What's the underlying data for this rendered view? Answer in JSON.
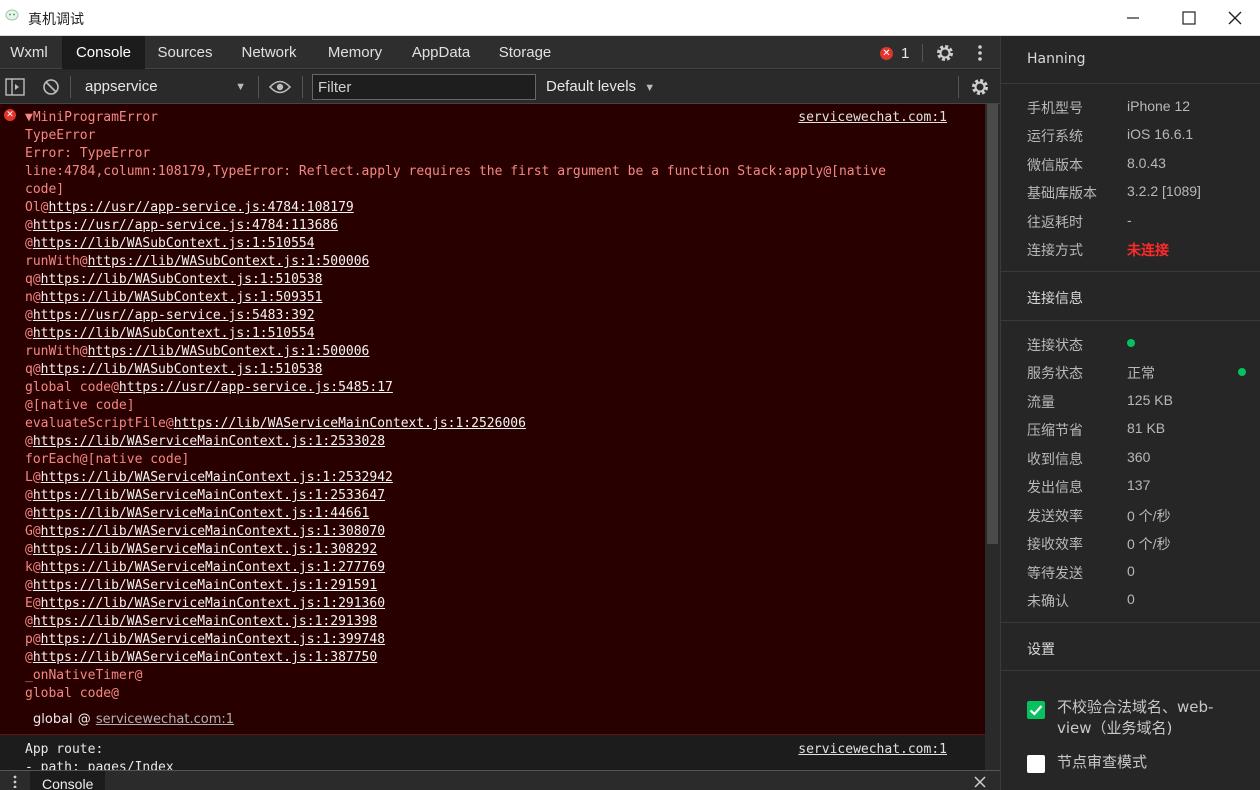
{
  "window": {
    "title": "真机调试"
  },
  "tabs": [
    "Wxml",
    "Console",
    "Sources",
    "Network",
    "Memory",
    "AppData",
    "Storage"
  ],
  "error_count": "1",
  "toolbar": {
    "context": "appservice",
    "filter_placeholder": "Filter",
    "levels": "Default levels"
  },
  "console": {
    "error_source": "servicewechat.com:1",
    "error_lines": [
      "▼MiniProgramError",
      "TypeError",
      "Error: TypeError",
      "line:4784,column:108179,TypeError: Reflect.apply requires the first argument be a function Stack:apply@[native",
      "code]",
      "Ol@https://usr//app-service.js:4784:108179",
      "@https://usr//app-service.js:4784:113686",
      "@https://lib/WASubContext.js:1:510554",
      "runWith@https://lib/WASubContext.js:1:500006",
      "q@https://lib/WASubContext.js:1:510538",
      "n@https://lib/WASubContext.js:1:509351",
      "@https://usr//app-service.js:5483:392",
      "@https://lib/WASubContext.js:1:510554",
      "runWith@https://lib/WASubContext.js:1:500006",
      "q@https://lib/WASubContext.js:1:510538",
      "global code@https://usr//app-service.js:5485:17",
      "@[native code]",
      "evaluateScriptFile@https://lib/WAServiceMainContext.js:1:2526006",
      "@https://lib/WAServiceMainContext.js:1:2533028",
      "forEach@[native code]",
      "L@https://lib/WAServiceMainContext.js:1:2532942",
      "@https://lib/WAServiceMainContext.js:1:2533647",
      "@https://lib/WAServiceMainContext.js:1:44661",
      "G@https://lib/WAServiceMainContext.js:1:308070",
      "@https://lib/WAServiceMainContext.js:1:308292",
      "k@https://lib/WAServiceMainContext.js:1:277769",
      "@https://lib/WAServiceMainContext.js:1:291591",
      "E@https://lib/WAServiceMainContext.js:1:291360",
      "@https://lib/WAServiceMainContext.js:1:291398",
      "p@https://lib/WAServiceMainContext.js:1:399748",
      "@https://lib/WAServiceMainContext.js:1:387750",
      "_onNativeTimer@",
      "global code@"
    ],
    "global_label": "global",
    "global_at": "@",
    "global_link": "servicewechat.com:1",
    "route_source": "servicewechat.com:1",
    "route_lines": [
      "App route:",
      "- path: pages/Index"
    ]
  },
  "drawer": {
    "tab": "Console"
  },
  "info": {
    "device_name": "Hanning",
    "device_rows": [
      {
        "k": "手机型号",
        "v": "iPhone 12"
      },
      {
        "k": "运行系统",
        "v": "iOS 16.6.1"
      },
      {
        "k": "微信版本",
        "v": "8.0.43"
      },
      {
        "k": "基础库版本",
        "v": "3.2.2 [1089]"
      },
      {
        "k": "往返耗时",
        "v": "-"
      },
      {
        "k": "连接方式",
        "v": "未连接"
      }
    ],
    "conn_title": "连接信息",
    "conn_rows": [
      {
        "k": "连接状态",
        "v": ""
      },
      {
        "k": "服务状态",
        "v": "正常"
      },
      {
        "k": "流量",
        "v": "125 KB"
      },
      {
        "k": "压缩节省",
        "v": "81 KB"
      },
      {
        "k": "收到信息",
        "v": "360"
      },
      {
        "k": "发出信息",
        "v": "137"
      },
      {
        "k": "发送效率",
        "v": "0 个/秒"
      },
      {
        "k": "接收效率",
        "v": "0 个/秒"
      },
      {
        "k": "等待发送",
        "v": "0"
      },
      {
        "k": "未确认",
        "v": "0"
      }
    ],
    "settings_title": "设置",
    "settings": [
      {
        "label": "不校验合法域名、web-view（业务域名)",
        "checked": true
      },
      {
        "label": "节点审查模式",
        "checked": false
      }
    ]
  },
  "colors": {
    "accent_green": "#07c160",
    "error_red": "#e0352b",
    "disconnected_red": "#ff2a2a"
  }
}
